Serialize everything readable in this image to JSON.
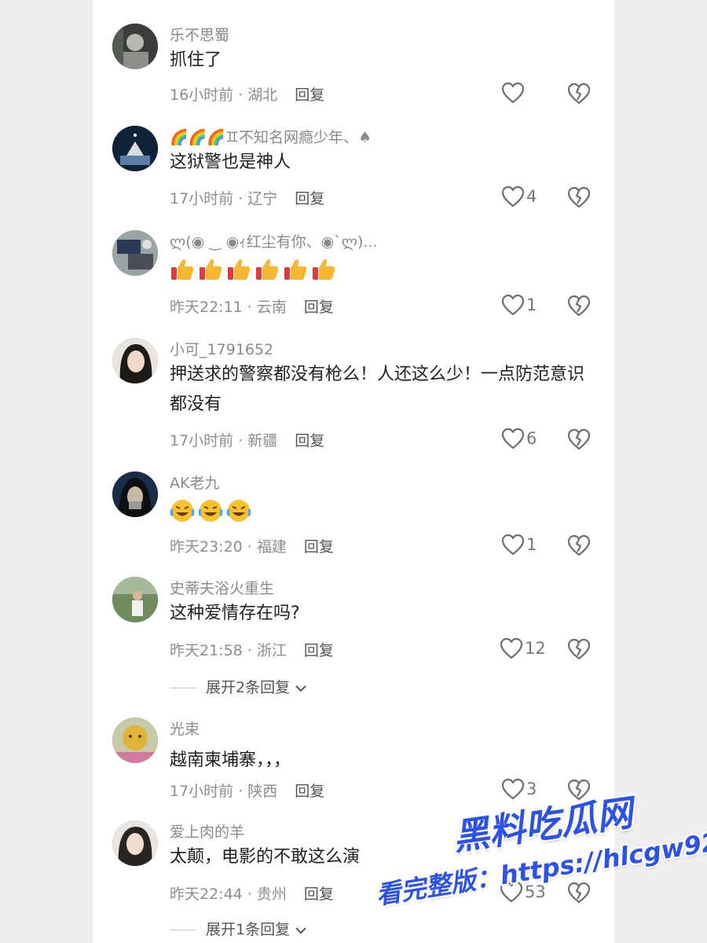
{
  "comments": [
    {
      "username": "乐不思蜀",
      "text": "抓住了",
      "time": "16小时前",
      "location": "湖北",
      "reply": "回复",
      "likes": ""
    },
    {
      "username": "🌈🌈🌈♊不知名网瘾少年、♠",
      "text": "这狱警也是神人",
      "time": "17小时前",
      "location": "辽宁",
      "reply": "回复",
      "likes": "4"
    },
    {
      "username": "ლ(◉ ‿ ◉ｨ红尘有你、◉`ლ)...",
      "emoji": "👍👍👍👍👍👍",
      "time": "昨天22:11",
      "location": "云南",
      "reply": "回复",
      "likes": "1"
    },
    {
      "username": "小可_1791652",
      "text": "押送求的警察都没有枪么！人还这么少！一点防范意识都没有",
      "time": "17小时前",
      "location": "新疆",
      "reply": "回复",
      "likes": "6"
    },
    {
      "username": "AK老九",
      "emoji": "😭😭😭",
      "time": "昨天23:20",
      "location": "福建",
      "reply": "回复",
      "likes": "1"
    },
    {
      "username": "史蒂夫浴火重生",
      "text": "这种爱情存在吗?",
      "time": "昨天21:58",
      "location": "浙江",
      "reply": "回复",
      "likes": "12",
      "expand": "展开2条回复"
    },
    {
      "username": "光束",
      "text": "越南柬埔寨，，，",
      "time": "17小时前",
      "location": "陕西",
      "reply": "回复",
      "likes": "3"
    },
    {
      "username": "爱上肉的羊",
      "text": "太颠，电影的不敢这么演",
      "time": "昨天22:44",
      "location": "贵州",
      "reply": "回复",
      "likes": "53",
      "expand": "展开1条回复"
    }
  ],
  "watermark": {
    "line1": "黑料吃瓜网",
    "line2": "看完整版：https://hlcgw92.com"
  },
  "colors": {
    "panel": "#ffffff",
    "background": "#efefef",
    "meta": "#8d8d8d",
    "watermark": "#2d52e8"
  }
}
